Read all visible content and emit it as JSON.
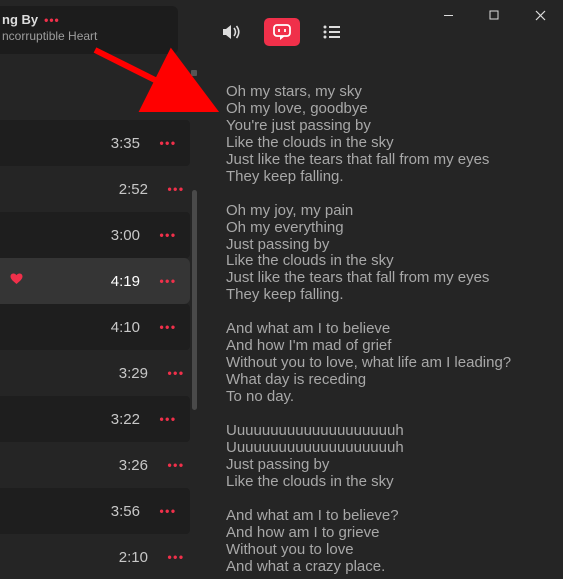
{
  "window": {
    "min": "–",
    "max": "▢",
    "close": "✕"
  },
  "now_playing": {
    "title_fragment": "ng By",
    "subtitle_fragment": "ncorruptible Heart",
    "more": "•••"
  },
  "colors": {
    "accent": "#f0304a"
  },
  "tracks": [
    {
      "duration": "3:35",
      "alt": true,
      "active": false,
      "fav": false
    },
    {
      "duration": "2:52",
      "alt": false,
      "active": false,
      "fav": false
    },
    {
      "duration": "3:00",
      "alt": true,
      "active": false,
      "fav": false
    },
    {
      "duration": "4:19",
      "alt": false,
      "active": true,
      "fav": true
    },
    {
      "duration": "4:10",
      "alt": true,
      "active": false,
      "fav": false
    },
    {
      "duration": "3:29",
      "alt": false,
      "active": false,
      "fav": false
    },
    {
      "duration": "3:22",
      "alt": true,
      "active": false,
      "fav": false
    },
    {
      "duration": "3:26",
      "alt": false,
      "active": false,
      "fav": false
    },
    {
      "duration": "3:56",
      "alt": true,
      "active": false,
      "fav": false
    },
    {
      "duration": "2:10",
      "alt": false,
      "active": false,
      "fav": false
    }
  ],
  "track_more": "•••",
  "lyrics": [
    "Oh my stars, my sky\nOh my love, goodbye\nYou're just passing by\nLike the clouds in the sky\nJust like the tears that fall from my eyes\nThey keep falling.",
    "Oh my joy, my pain\nOh my everything\nJust passing by\nLike the clouds in the sky\nJust like the tears that fall from my eyes\nThey keep falling.",
    "And what am I to believe\nAnd how I'm mad of grief\nWithout you to love, what life am I leading?\nWhat day is receding\nTo no day.",
    "Uuuuuuuuuuuuuuuuuuuuh\nUuuuuuuuuuuuuuuuuuuuh\nJust passing by\nLike the clouds in the sky",
    "And what am I to believe?\nAnd how am I to grieve\nWithout you to love\nAnd what a crazy place."
  ]
}
